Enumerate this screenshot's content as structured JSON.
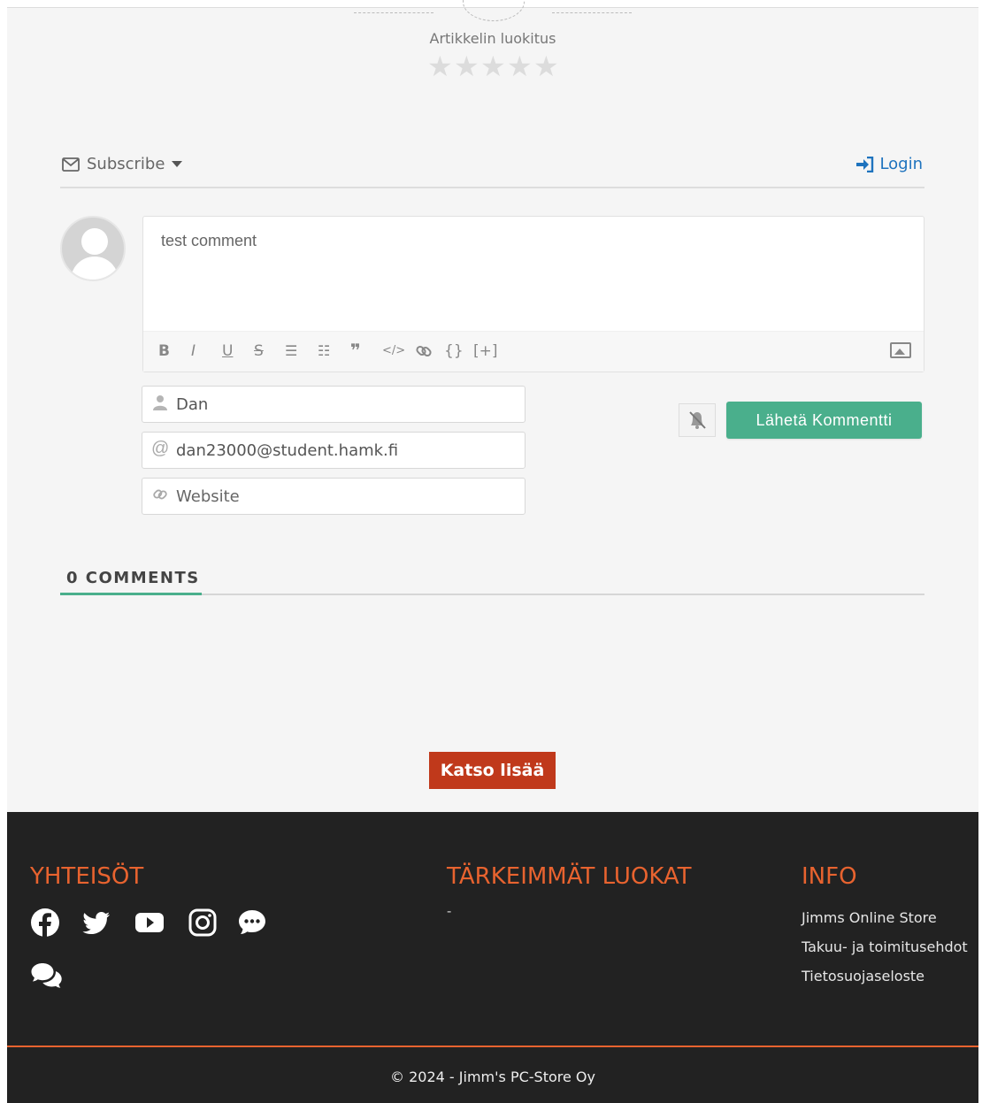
{
  "rating": {
    "title": "Artikkelin luokitus",
    "stars_total": 5,
    "stars_filled": 0
  },
  "subscribe_bar": {
    "subscribe_label": "Subscribe",
    "login_label": "Login"
  },
  "comment_form": {
    "comment_text": "test comment",
    "toolbar": [
      "B",
      "I",
      "U",
      "S",
      "ordered-list",
      "bullet-list",
      "quote",
      "code",
      "link",
      "{}",
      "[+]",
      "image"
    ],
    "name_value": "Dan",
    "email_value": "dan23000@student.hamk.fi",
    "website_placeholder": "Website",
    "submit_label": "Lähetä Kommentti"
  },
  "comments": {
    "count_label": "0 COMMENTS"
  },
  "more_button_label": "Katso lisää",
  "footer": {
    "community_title": "YHTEISÖT",
    "categories_title": "TÄRKEIMMÄT LUOKAT",
    "categories_placeholder": "-",
    "info_title": "INFO",
    "info_links": [
      "Jimms Online Store",
      "Takuu- ja toimitusehdot",
      "Tietosuojaseloste"
    ],
    "social_icons": [
      "facebook-icon",
      "twitter-icon",
      "youtube-icon",
      "instagram-icon",
      "chat-bubble-icon",
      "discussion-icon"
    ],
    "copyright": "© 2024 - Jimm's PC-Store Oy"
  },
  "colors": {
    "accent_green": "#4aaf8c",
    "login_blue": "#1e73be",
    "button_red": "#c0391b",
    "footer_orange": "#e8632f",
    "footer_bg": "#222222"
  }
}
